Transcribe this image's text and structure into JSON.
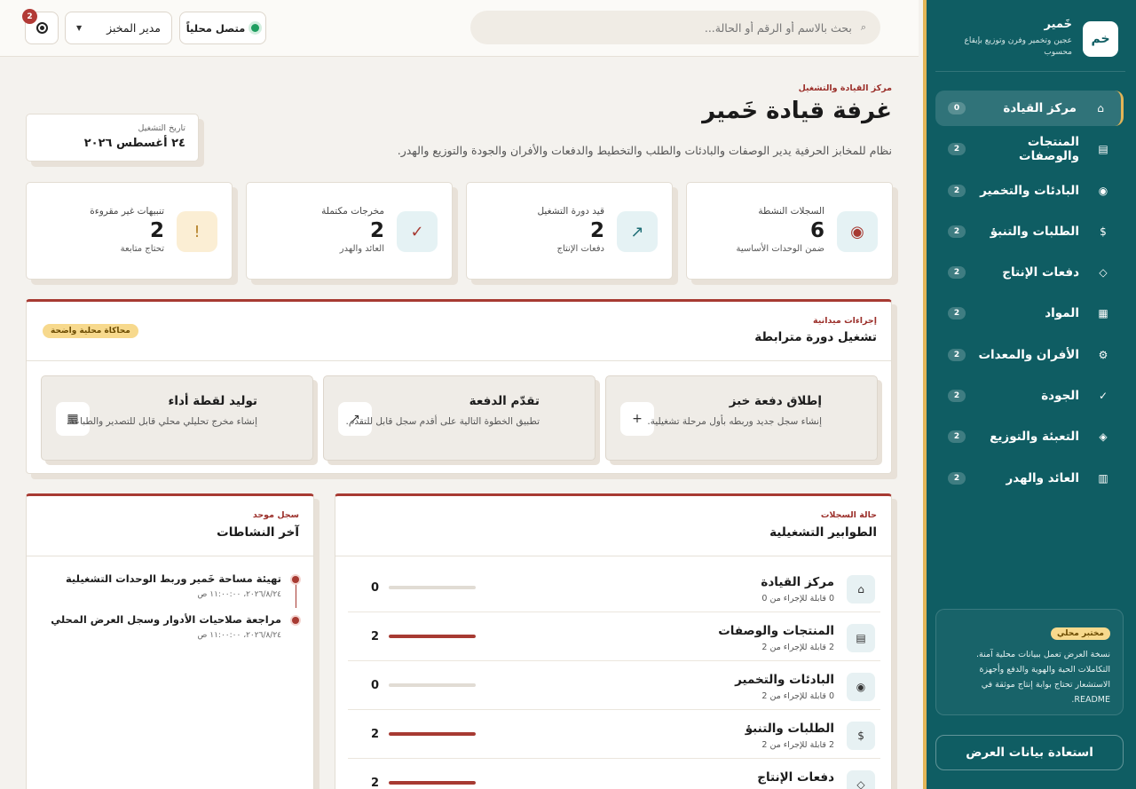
{
  "brand": {
    "logo": "خم",
    "name": "خَمير",
    "subtitle": "عجين وتخمير وفرن وتوزيع بإيقاع محسوب"
  },
  "sidebar": {
    "items": [
      {
        "label": "مركز القيادة",
        "count": "0",
        "icon": "⌂",
        "icon_name": "home-icon",
        "active": true
      },
      {
        "label": "المنتجات والوصفات",
        "count": "2",
        "icon": "▤",
        "icon_name": "list-icon"
      },
      {
        "label": "البادئات والتخمير",
        "count": "2",
        "icon": "◉",
        "icon_name": "culture-icon"
      },
      {
        "label": "الطلبات والتنبؤ",
        "count": "2",
        "icon": "$",
        "icon_name": "dollar-icon"
      },
      {
        "label": "دفعات الإنتاج",
        "count": "2",
        "icon": "◇",
        "icon_name": "diamond-icon"
      },
      {
        "label": "المواد",
        "count": "2",
        "icon": "▦",
        "icon_name": "grid-icon"
      },
      {
        "label": "الأفران والمعدات",
        "count": "2",
        "icon": "⚙",
        "icon_name": "gear-icon"
      },
      {
        "label": "الجودة",
        "count": "2",
        "icon": "✓",
        "icon_name": "check-icon"
      },
      {
        "label": "التعبئة والتوزيع",
        "count": "2",
        "icon": "◈",
        "icon_name": "package-icon"
      },
      {
        "label": "العائد والهدر",
        "count": "2",
        "icon": "▥",
        "icon_name": "report-icon"
      }
    ],
    "note_badge": "مختبر محلي",
    "note_text": "نسخة العرض تعمل ببيانات محلية آمنة. التكاملات الحية والهوية والدفع وأجهزة الاستشعار تحتاج بوابة إنتاج موثقة في README.",
    "restore_label": "استعادة بيانات العرض"
  },
  "topbar": {
    "search_placeholder": "بحث بالاسم أو الرقم أو الحالة...",
    "status": "متصل محلياً",
    "role": "مدير المخبز",
    "notifications": "2"
  },
  "header": {
    "kicker": "مركز القيادة والتشغيل",
    "title": "غرفة قيادة خَمير",
    "description": "نظام للمخابز الحرفية يدير الوصفات والبادئات والطلب والتخطيط والدفعات والأفران والجودة والتوزيع والهدر.",
    "date_label": "تاريخ التشغيل",
    "date_value": "٢٤ أغسطس ٢٠٢٦"
  },
  "stats": [
    {
      "label": "السجلات النشطة",
      "value": "6",
      "sub": "ضمن الوحدات الأساسية",
      "icon": "◉",
      "icon_name": "records-icon",
      "icon_bg": "#e5f2f4",
      "icon_color": "#a73a32"
    },
    {
      "label": "قيد دورة التشغيل",
      "value": "2",
      "sub": "دفعات الإنتاج",
      "icon": "↗",
      "icon_name": "trend-icon",
      "icon_bg": "#e5f2f4",
      "icon_color": "#1f6f76"
    },
    {
      "label": "مخرجات مكتملة",
      "value": "2",
      "sub": "العائد والهدر",
      "icon": "✓",
      "icon_name": "check-icon",
      "icon_bg": "#e5f2f4",
      "icon_color": "#a73a32"
    },
    {
      "label": "تنبيهات غير مقروءة",
      "value": "2",
      "sub": "تحتاج متابعة",
      "icon": "!",
      "icon_name": "alert-icon",
      "icon_bg": "#fbeed4",
      "icon_color": "#b5822a"
    }
  ],
  "actions_panel": {
    "kicker": "إجراءات ميدانية",
    "title": "تشغيل دورة مترابطة",
    "badge": "محاكاة محلية واضحة",
    "actions": [
      {
        "title": "إطلاق دفعة خبز",
        "desc": "إنشاء سجل جديد وربطه بأول مرحلة تشغيلية.",
        "icon": "+",
        "icon_name": "plus-icon"
      },
      {
        "title": "تقدّم الدفعة",
        "desc": "تطبيق الخطوة التالية على أقدم سجل قابل للتقدم.",
        "icon": "↗",
        "icon_name": "advance-icon"
      },
      {
        "title": "توليد لقطة أداء",
        "desc": "إنشاء مخرج تحليلي محلي قابل للتصدير والطباعة.",
        "icon": "▦",
        "icon_name": "snapshot-icon"
      }
    ]
  },
  "queues_panel": {
    "kicker": "حالة السجلات",
    "title": "الطوابير التشغيلية",
    "rows": [
      {
        "name": "مركز القيادة",
        "sub": "0 قابلة للإجراء من 0",
        "count": "0",
        "fill": 0,
        "icon": "⌂",
        "icon_name": "home-icon"
      },
      {
        "name": "المنتجات والوصفات",
        "sub": "2 قابلة للإجراء من 2",
        "count": "2",
        "fill": 1,
        "icon": "▤",
        "icon_name": "list-icon"
      },
      {
        "name": "البادئات والتخمير",
        "sub": "0 قابلة للإجراء من 2",
        "count": "0",
        "fill": 0,
        "icon": "◉",
        "icon_name": "culture-icon"
      },
      {
        "name": "الطلبات والتنبؤ",
        "sub": "2 قابلة للإجراء من 2",
        "count": "2",
        "fill": 1,
        "icon": "$",
        "icon_name": "dollar-icon"
      },
      {
        "name": "دفعات الإنتاج",
        "sub": "",
        "count": "2",
        "fill": 1,
        "icon": "◇",
        "icon_name": "diamond-icon"
      }
    ]
  },
  "activity_panel": {
    "kicker": "سجل موحد",
    "title": "آخر النشاطات",
    "items": [
      {
        "title": "تهيئة مساحة خَمير وربط الوحدات التشغيلية",
        "time": "٢٠٢٦/٨/٢٤، ١١:٠٠:٠٠ ص"
      },
      {
        "title": "مراجعة صلاحيات الأدوار وسجل العرض المحلي",
        "time": "٢٠٢٦/٨/٢٤، ١١:٠٠:٠٠ ص"
      }
    ]
  },
  "colors": {
    "sidebar": "#0f5d63",
    "accent": "#a73a32",
    "gold": "#e2b557",
    "online": "#1f9e60"
  }
}
